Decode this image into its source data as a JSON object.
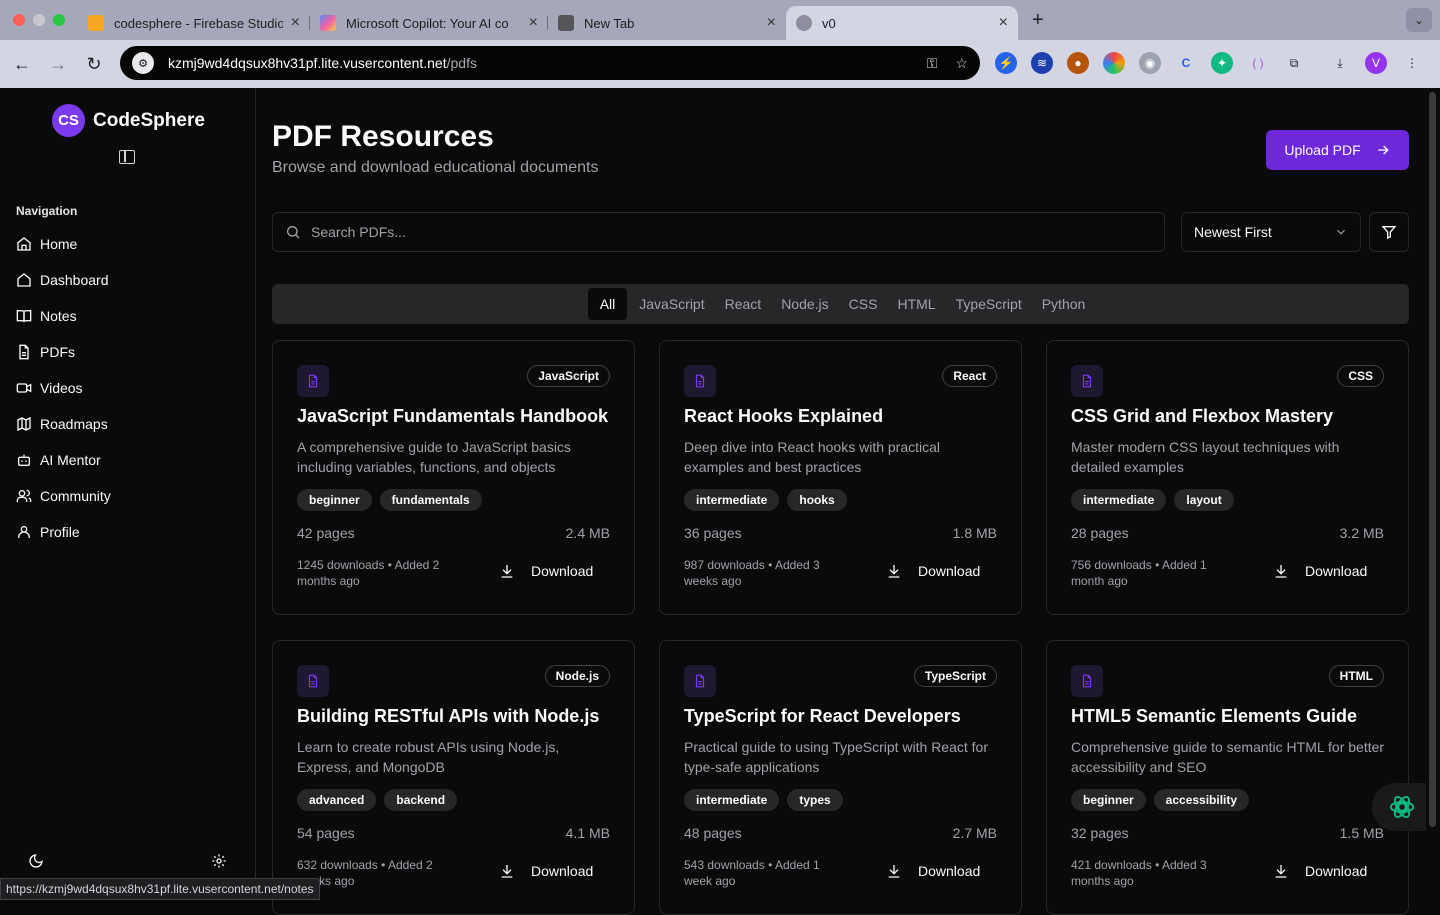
{
  "browser": {
    "tabs": [
      {
        "title": "codesphere - Firebase Studio",
        "fav": "#f5a623"
      },
      {
        "title": "Microsoft Copilot: Your AI co",
        "fav": "#4f8ef7"
      },
      {
        "title": "New Tab",
        "fav": "#555555"
      },
      {
        "title": "v0",
        "fav": "#8e8ea0"
      }
    ],
    "url_host": "kzmj9wd4dqsux8hv31pf.lite.vusercontent.net",
    "url_path": "/pdfs",
    "status_url": "https://kzmj9wd4dqsux8hv31pf.lite.vusercontent.net/notes",
    "profile_initial": "V"
  },
  "sidebar": {
    "brand_initials": "CS",
    "brand_name": "CodeSphere",
    "nav_heading": "Navigation",
    "items": [
      {
        "label": "Home",
        "icon": "home-icon"
      },
      {
        "label": "Dashboard",
        "icon": "dashboard-icon"
      },
      {
        "label": "Notes",
        "icon": "book-icon"
      },
      {
        "label": "PDFs",
        "icon": "file-icon"
      },
      {
        "label": "Videos",
        "icon": "video-icon"
      },
      {
        "label": "Roadmaps",
        "icon": "map-icon"
      },
      {
        "label": "AI Mentor",
        "icon": "bot-icon"
      },
      {
        "label": "Community",
        "icon": "users-icon"
      },
      {
        "label": "Profile",
        "icon": "user-icon"
      }
    ]
  },
  "header": {
    "title": "PDF Resources",
    "subtitle": "Browse and download educational documents",
    "upload_label": "Upload PDF"
  },
  "search": {
    "placeholder": "Search PDFs..."
  },
  "sort": {
    "selected": "Newest First"
  },
  "categories": [
    "All",
    "JavaScript",
    "React",
    "Node.js",
    "CSS",
    "HTML",
    "TypeScript",
    "Python"
  ],
  "download_label": "Download",
  "accent": "#7c3aed",
  "cards": [
    {
      "badge": "JavaScript",
      "title": "JavaScript Fundamentals Handbook",
      "desc": "A comprehensive guide to JavaScript basics including variables, functions, and objects",
      "tags": [
        "beginner",
        "fundamentals"
      ],
      "pages": "42 pages",
      "size": "2.4 MB",
      "meta": "1245 downloads • Added 2 months ago"
    },
    {
      "badge": "React",
      "title": "React Hooks Explained",
      "desc": "Deep dive into React hooks with practical examples and best practices",
      "tags": [
        "intermediate",
        "hooks"
      ],
      "pages": "36 pages",
      "size": "1.8 MB",
      "meta": "987 downloads • Added 3 weeks ago"
    },
    {
      "badge": "CSS",
      "title": "CSS Grid and Flexbox Mastery",
      "desc": "Master modern CSS layout techniques with detailed examples",
      "tags": [
        "intermediate",
        "layout"
      ],
      "pages": "28 pages",
      "size": "3.2 MB",
      "meta": "756 downloads • Added 1 month ago"
    },
    {
      "badge": "Node.js",
      "title": "Building RESTful APIs with Node.js",
      "desc": "Learn to create robust APIs using Node.js, Express, and MongoDB",
      "tags": [
        "advanced",
        "backend"
      ],
      "pages": "54 pages",
      "size": "4.1 MB",
      "meta": "632 downloads • Added 2 weeks ago"
    },
    {
      "badge": "TypeScript",
      "title": "TypeScript for React Developers",
      "desc": "Practical guide to using TypeScript with React for type-safe applications",
      "tags": [
        "intermediate",
        "types"
      ],
      "pages": "48 pages",
      "size": "2.7 MB",
      "meta": "543 downloads • Added 1 week ago"
    },
    {
      "badge": "HTML",
      "title": "HTML5 Semantic Elements Guide",
      "desc": "Comprehensive guide to semantic HTML for better accessibility and SEO",
      "tags": [
        "beginner",
        "accessibility"
      ],
      "pages": "32 pages",
      "size": "1.5 MB",
      "meta": "421 downloads • Added 3 months ago"
    }
  ]
}
